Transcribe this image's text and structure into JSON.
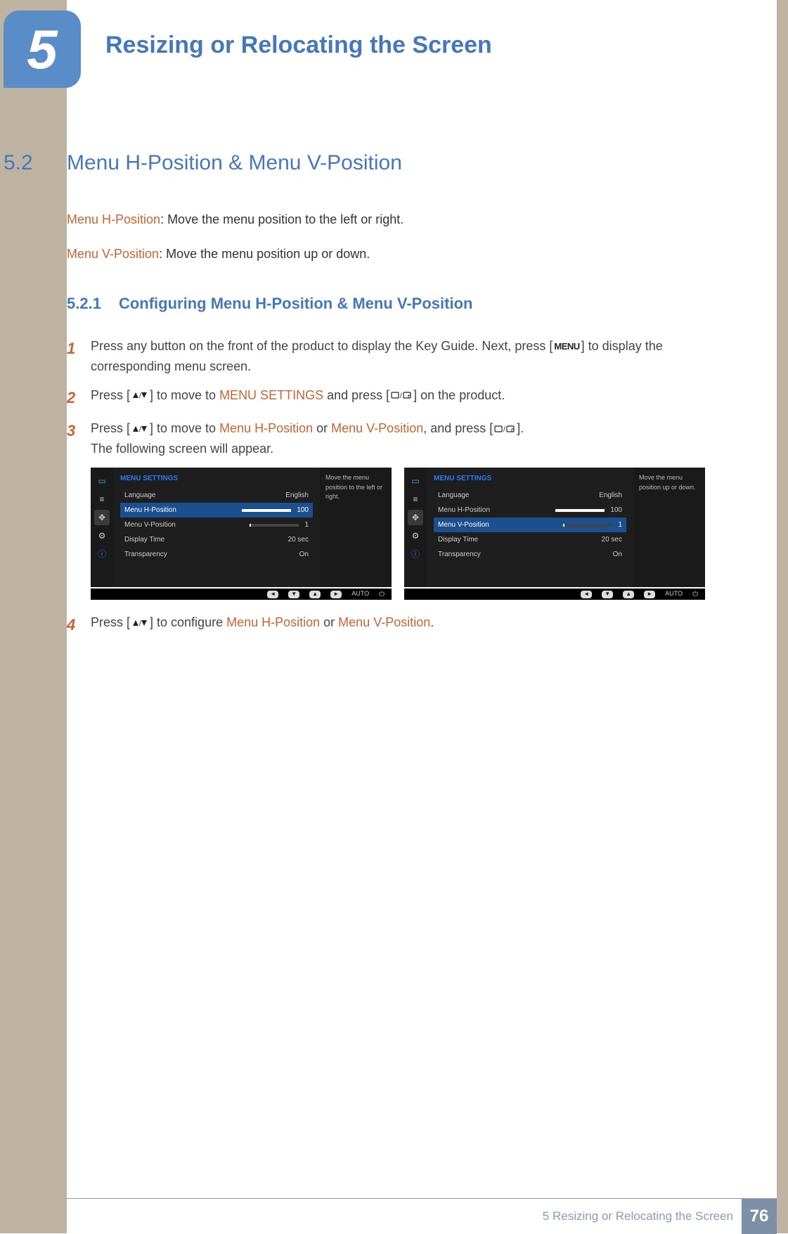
{
  "chapter": {
    "number": "5",
    "title": "Resizing or Relocating the Screen"
  },
  "section": {
    "number": "5.2",
    "title": "Menu H-Position & Menu V-Position"
  },
  "definitions": {
    "h_term": "Menu H-Position",
    "h_text": ": Move the menu position to the left or right.",
    "v_term": "Menu V-Position",
    "v_text": ": Move the menu position up or down."
  },
  "subsection": {
    "number": "5.2.1",
    "title": "Configuring Menu H-Position & Menu V-Position"
  },
  "steps": {
    "s1_num": "1",
    "s1_a": "Press any button on the front of the product to display the Key Guide. Next, press [",
    "s1_menu": "MENU",
    "s1_b": "] to display the corresponding menu screen.",
    "s2_num": "2",
    "s2_a": "Press [",
    "s2_b": "] to move to ",
    "s2_ref": "MENU SETTINGS",
    "s2_c": " and press [",
    "s2_d": "] on the product.",
    "s3_num": "3",
    "s3_a": "Press [",
    "s3_b": "] to move to ",
    "s3_ref1": "Menu H-Position",
    "s3_or": " or ",
    "s3_ref2": "Menu V-Position",
    "s3_c": ", and press [",
    "s3_d": "].",
    "s3_follow": "The following screen will appear.",
    "s4_num": "4",
    "s4_a": "Press [",
    "s4_b": "] to configure ",
    "s4_ref1": "Menu H-Position",
    "s4_or": " or ",
    "s4_ref2": "Menu V-Position",
    "s4_c": "."
  },
  "osd": {
    "heading": "MENU SETTINGS",
    "rows": {
      "language_label": "Language",
      "language_val": "English",
      "hpos_label": "Menu H-Position",
      "hpos_val": "100",
      "vpos_label": "Menu V-Position",
      "vpos_val": "1",
      "display_time_label": "Display Time",
      "display_time_val": "20 sec",
      "transparency_label": "Transparency",
      "transparency_val": "On"
    },
    "hint_left": "Move the menu position to the left or right.",
    "hint_right": "Move the menu position up or down.",
    "footer_auto": "AUTO"
  },
  "footer": {
    "text": "5 Resizing or Relocating the Screen",
    "page": "76"
  },
  "chart_data": {
    "type": "table",
    "title": "MENU SETTINGS OSD values",
    "rows": [
      {
        "label": "Language",
        "value": "English"
      },
      {
        "label": "Menu H-Position",
        "value": 100
      },
      {
        "label": "Menu V-Position",
        "value": 1
      },
      {
        "label": "Display Time",
        "value": "20 sec"
      },
      {
        "label": "Transparency",
        "value": "On"
      }
    ]
  }
}
